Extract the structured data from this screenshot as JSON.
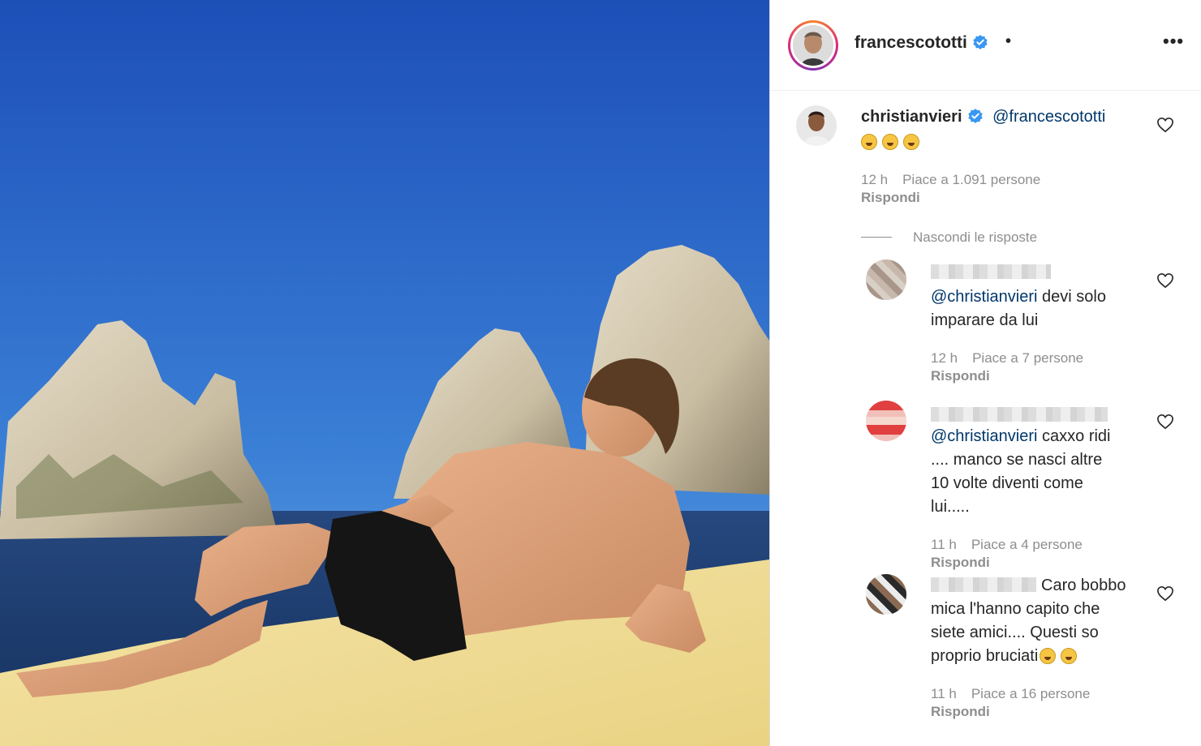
{
  "header": {
    "username": "francescototti",
    "separator": "•",
    "more": "•••"
  },
  "comments": [
    {
      "username": "christianvieri",
      "mention": "@francescototti",
      "emojis": [
        "laughing-emoji",
        "laughing-emoji",
        "laughing-emoji"
      ],
      "time": "12 h",
      "likes": "Piace a 1.091 persone",
      "reply": "Rispondi"
    }
  ],
  "replies_toggle": "Nascondi le risposte",
  "replies": [
    {
      "mention": "@christianvieri",
      "text": " devi solo",
      "text2": "imparare da lui",
      "time": "12 h",
      "likes": "Piace a 7 persone",
      "reply": "Rispondi"
    },
    {
      "mention": "@christianvieri",
      "text": " caxxo ridi",
      "text2": ".... manco se nasci altre",
      "text3": "10 volte diventi come",
      "text4": "lui.....",
      "time": "11 h",
      "likes": "Piace a 4 persone",
      "reply": "Rispondi"
    },
    {
      "text": "Caro bobbo",
      "text2": "mica l'hanno capito che",
      "text3": "siete amici.... Questi so",
      "text4": "proprio bruciati",
      "time": "11 h",
      "likes": "Piace a 16 persone",
      "reply": "Rispondi"
    }
  ],
  "colors": {
    "verified": "#3897f0",
    "mention": "#00376b",
    "meta": "#8e8e8e",
    "sky_top": "#1d4fb8",
    "sea": "#1b3a6e",
    "mat": "#f0dc98"
  }
}
